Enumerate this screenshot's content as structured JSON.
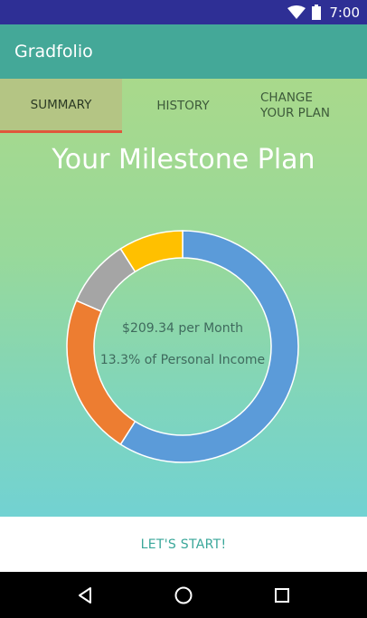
{
  "status_bar": {
    "time": "7:00",
    "icons": [
      "wifi-icon",
      "battery-icon"
    ]
  },
  "app": {
    "title": "Gradfolio"
  },
  "tabs": [
    {
      "label": "SUMMARY",
      "selected": true
    },
    {
      "label": "HISTORY",
      "selected": false
    },
    {
      "label": "CHANGE YOUR PLAN",
      "selected": false
    }
  ],
  "summary": {
    "title": "Your Milestone Plan",
    "per_month": "$209.34 per Month",
    "percent_income": "13.3% of Personal Income"
  },
  "donut": {
    "segments": [
      {
        "color": "#5b9bd9",
        "fraction": 0.59
      },
      {
        "color": "#ed7d31",
        "fraction": 0.225
      },
      {
        "color": "#a5a5a5",
        "fraction": 0.095
      },
      {
        "color": "#ffc000",
        "fraction": 0.09
      }
    ]
  },
  "actions": {
    "start_label": "LET'S START!"
  },
  "colors": {
    "status_bar": "#2e2f95",
    "app_bar": "#44a898",
    "tab_selected_bg": "#b4c584",
    "tab_indicator": "#e0573c",
    "accent": "#3aa79a"
  },
  "nav_bar": {
    "icons": [
      "back-icon",
      "home-icon",
      "recents-icon"
    ]
  }
}
